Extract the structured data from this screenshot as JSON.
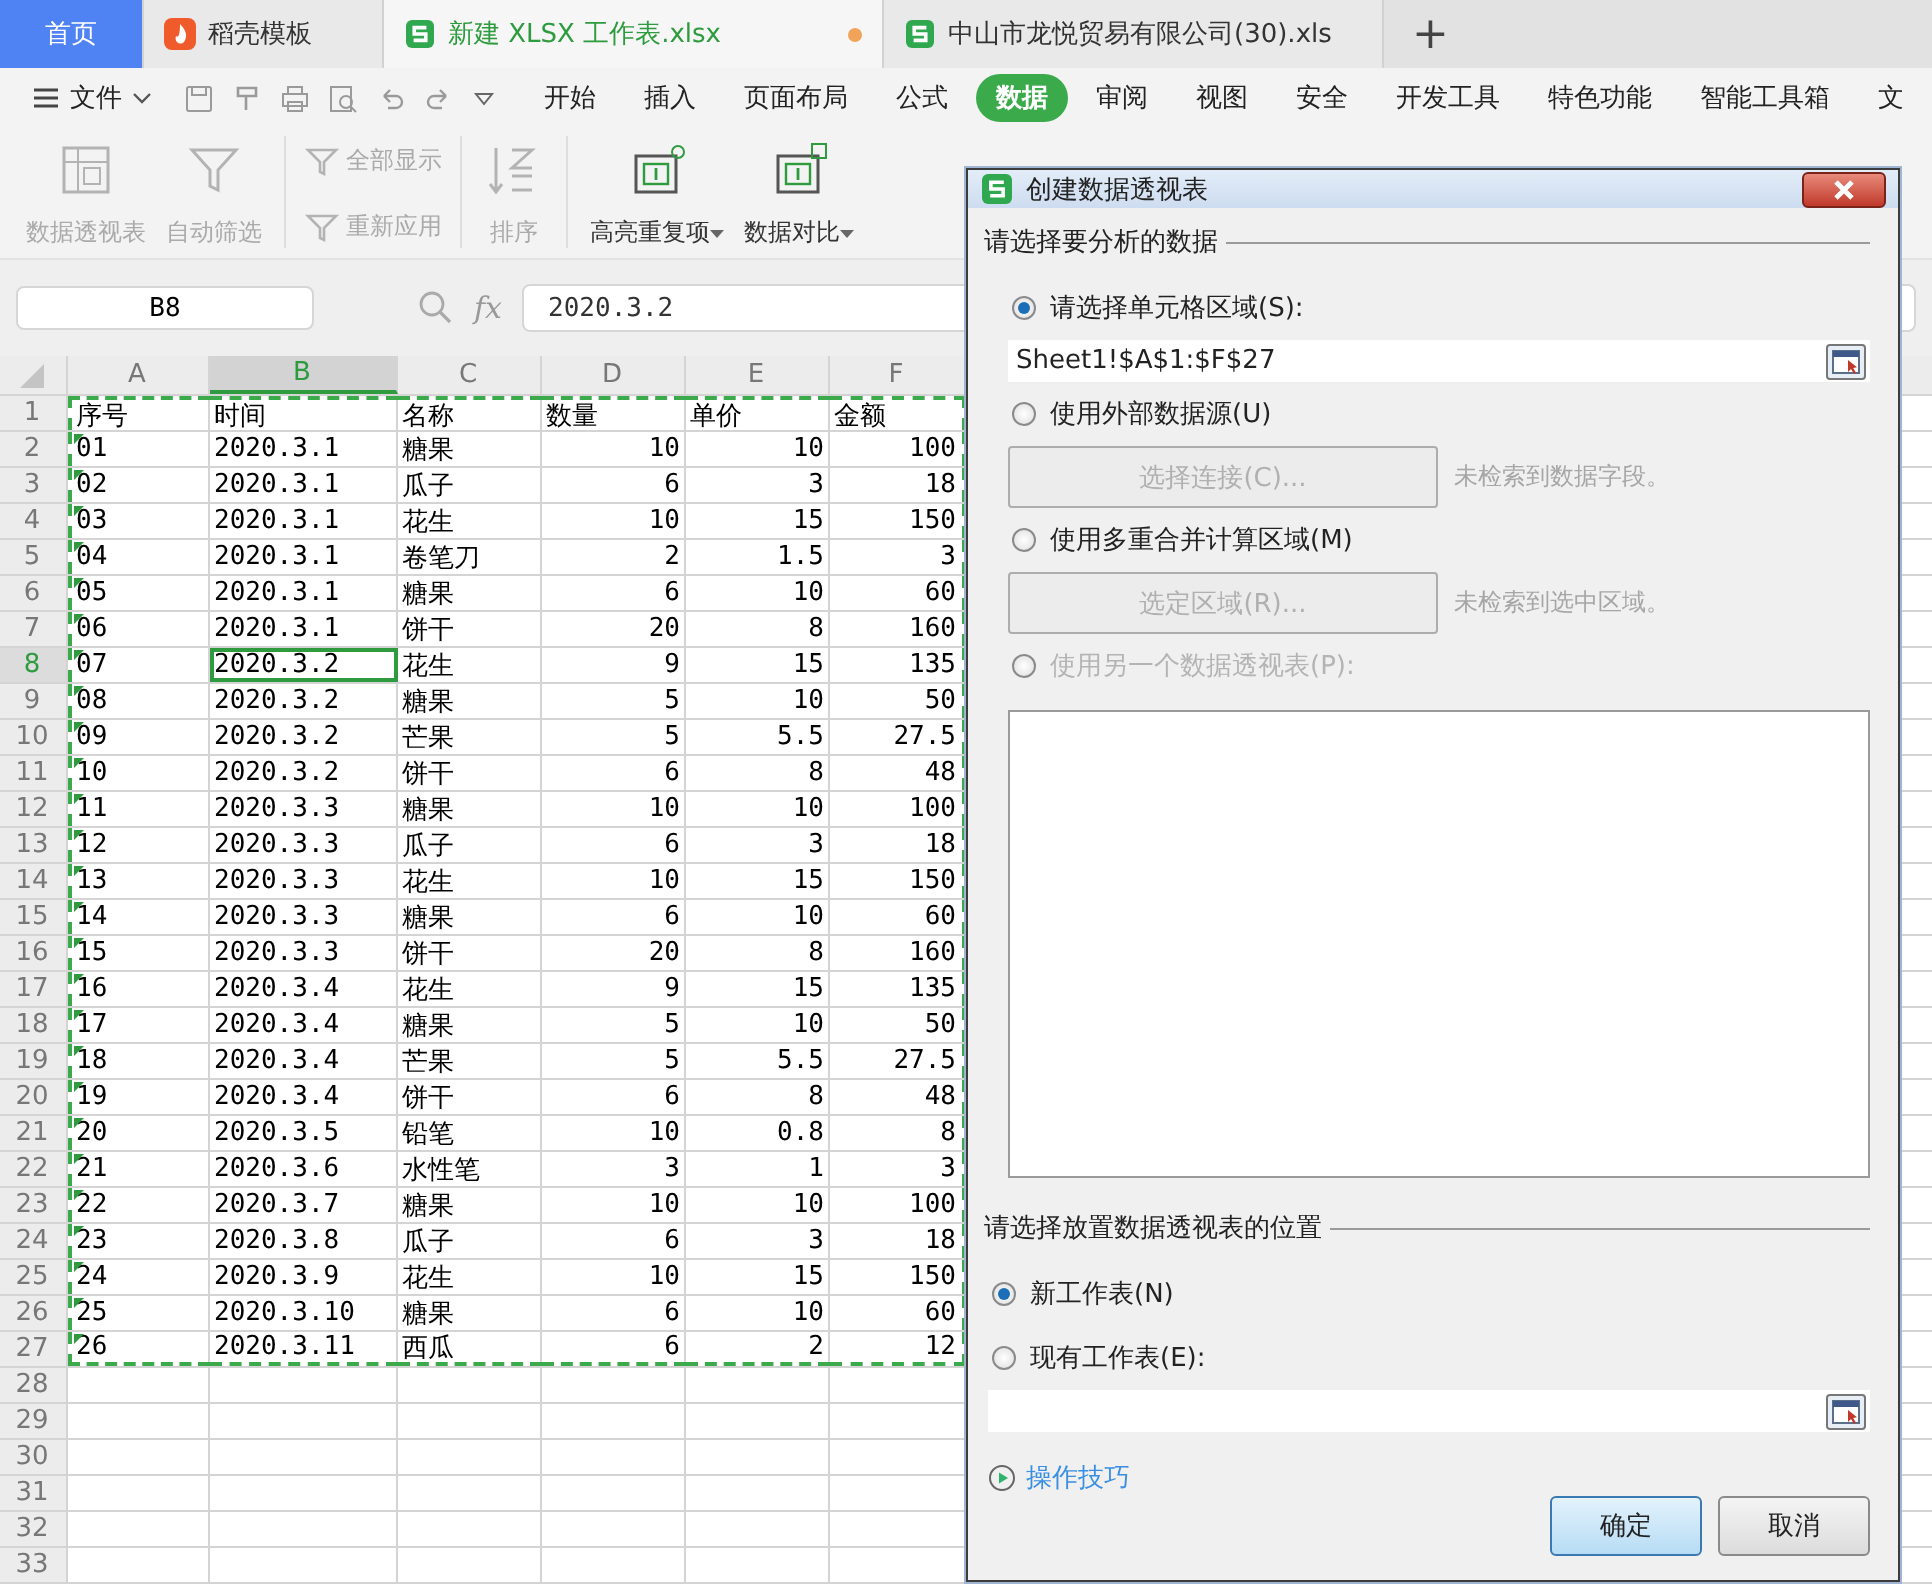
{
  "tabs": [
    {
      "kind": "home",
      "label": "首页",
      "selected": false,
      "modified": false
    },
    {
      "kind": "template",
      "label": "稻壳模板",
      "selected": false,
      "modified": false
    },
    {
      "kind": "sheet",
      "label": "新建 XLSX 工作表.xlsx",
      "selected": true,
      "modified": true
    },
    {
      "kind": "sheet",
      "label": "中山市龙悦贸易有限公司(30).xls",
      "selected": false,
      "modified": false
    }
  ],
  "new_tab": "+",
  "menu": {
    "file": "文件",
    "ribbon_tabs": [
      {
        "label": "开始",
        "selected": false
      },
      {
        "label": "插入",
        "selected": false
      },
      {
        "label": "页面布局",
        "selected": false
      },
      {
        "label": "公式",
        "selected": false
      },
      {
        "label": "数据",
        "selected": true
      },
      {
        "label": "审阅",
        "selected": false
      },
      {
        "label": "视图",
        "selected": false
      },
      {
        "label": "安全",
        "selected": false
      },
      {
        "label": "开发工具",
        "selected": false
      },
      {
        "label": "特色功能",
        "selected": false
      },
      {
        "label": "智能工具箱",
        "selected": false
      },
      {
        "label": "文",
        "selected": false
      }
    ]
  },
  "ribbon": [
    {
      "kind": "large",
      "label": "数据透视表",
      "disabled": true,
      "dropdown": false
    },
    {
      "kind": "large",
      "label": "自动筛选",
      "disabled": true,
      "dropdown": false
    },
    {
      "kind": "small",
      "label": "全部显示",
      "disabled": true,
      "dropdown": false
    },
    {
      "kind": "small",
      "label": "重新应用",
      "disabled": true,
      "dropdown": false
    },
    {
      "kind": "large",
      "label": "排序",
      "disabled": true,
      "dropdown": false
    },
    {
      "kind": "large",
      "label": "高亮重复项",
      "disabled": false,
      "dropdown": true
    },
    {
      "kind": "large",
      "label": "数据对比",
      "disabled": false,
      "dropdown": true
    }
  ],
  "formula_bar": {
    "cell_ref": "B8",
    "fx_label": "fx",
    "value": "2020.3.2"
  },
  "sheet": {
    "copy_marquee": true,
    "columns": [
      {
        "label": "A",
        "selected": false,
        "kind": "text-number"
      },
      {
        "label": "B",
        "selected": true,
        "kind": "text"
      },
      {
        "label": "C",
        "selected": false,
        "kind": "text"
      },
      {
        "label": "D",
        "selected": false,
        "kind": "number"
      },
      {
        "label": "E",
        "selected": false,
        "kind": "number"
      },
      {
        "label": "F",
        "selected": false,
        "kind": "number"
      }
    ],
    "rows": [
      {
        "header": "1",
        "kind": "labels",
        "selected": false,
        "cells": [
          "序号",
          "时间",
          "名称",
          "数量",
          "单价",
          "金额"
        ]
      },
      {
        "header": "2",
        "kind": "data",
        "selected": false,
        "cells": [
          "01",
          "2020.3.1",
          "糖果",
          "10",
          "10",
          "100"
        ]
      },
      {
        "header": "3",
        "kind": "data",
        "selected": false,
        "cells": [
          "02",
          "2020.3.1",
          "瓜子",
          "6",
          "3",
          "18"
        ]
      },
      {
        "header": "4",
        "kind": "data",
        "selected": false,
        "cells": [
          "03",
          "2020.3.1",
          "花生",
          "10",
          "15",
          "150"
        ]
      },
      {
        "header": "5",
        "kind": "data",
        "selected": false,
        "cells": [
          "04",
          "2020.3.1",
          "卷笔刀",
          "2",
          "1.5",
          "3"
        ]
      },
      {
        "header": "6",
        "kind": "data",
        "selected": false,
        "cells": [
          "05",
          "2020.3.1",
          "糖果",
          "6",
          "10",
          "60"
        ]
      },
      {
        "header": "7",
        "kind": "data",
        "selected": false,
        "cells": [
          "06",
          "2020.3.1",
          "饼干",
          "20",
          "8",
          "160"
        ]
      },
      {
        "header": "8",
        "kind": "data",
        "selected": true,
        "cells": [
          "07",
          "2020.3.2",
          "花生",
          "9",
          "15",
          "135"
        ]
      },
      {
        "header": "9",
        "kind": "data",
        "selected": false,
        "cells": [
          "08",
          "2020.3.2",
          "糖果",
          "5",
          "10",
          "50"
        ]
      },
      {
        "header": "10",
        "kind": "data",
        "selected": false,
        "cells": [
          "09",
          "2020.3.2",
          "芒果",
          "5",
          "5.5",
          "27.5"
        ]
      },
      {
        "header": "11",
        "kind": "data",
        "selected": false,
        "cells": [
          "10",
          "2020.3.2",
          "饼干",
          "6",
          "8",
          "48"
        ]
      },
      {
        "header": "12",
        "kind": "data",
        "selected": false,
        "cells": [
          "11",
          "2020.3.3",
          "糖果",
          "10",
          "10",
          "100"
        ]
      },
      {
        "header": "13",
        "kind": "data",
        "selected": false,
        "cells": [
          "12",
          "2020.3.3",
          "瓜子",
          "6",
          "3",
          "18"
        ]
      },
      {
        "header": "14",
        "kind": "data",
        "selected": false,
        "cells": [
          "13",
          "2020.3.3",
          "花生",
          "10",
          "15",
          "150"
        ]
      },
      {
        "header": "15",
        "kind": "data",
        "selected": false,
        "cells": [
          "14",
          "2020.3.3",
          "糖果",
          "6",
          "10",
          "60"
        ]
      },
      {
        "header": "16",
        "kind": "data",
        "selected": false,
        "cells": [
          "15",
          "2020.3.3",
          "饼干",
          "20",
          "8",
          "160"
        ]
      },
      {
        "header": "17",
        "kind": "data",
        "selected": false,
        "cells": [
          "16",
          "2020.3.4",
          "花生",
          "9",
          "15",
          "135"
        ]
      },
      {
        "header": "18",
        "kind": "data",
        "selected": false,
        "cells": [
          "17",
          "2020.3.4",
          "糖果",
          "5",
          "10",
          "50"
        ]
      },
      {
        "header": "19",
        "kind": "data",
        "selected": false,
        "cells": [
          "18",
          "2020.3.4",
          "芒果",
          "5",
          "5.5",
          "27.5"
        ]
      },
      {
        "header": "20",
        "kind": "data",
        "selected": false,
        "cells": [
          "19",
          "2020.3.4",
          "饼干",
          "6",
          "8",
          "48"
        ]
      },
      {
        "header": "21",
        "kind": "data",
        "selected": false,
        "cells": [
          "20",
          "2020.3.5",
          "铅笔",
          "10",
          "0.8",
          "8"
        ]
      },
      {
        "header": "22",
        "kind": "data",
        "selected": false,
        "cells": [
          "21",
          "2020.3.6",
          "水性笔",
          "3",
          "1",
          "3"
        ]
      },
      {
        "header": "23",
        "kind": "data",
        "selected": false,
        "cells": [
          "22",
          "2020.3.7",
          "糖果",
          "10",
          "10",
          "100"
        ]
      },
      {
        "header": "24",
        "kind": "data",
        "selected": false,
        "cells": [
          "23",
          "2020.3.8",
          "瓜子",
          "6",
          "3",
          "18"
        ]
      },
      {
        "header": "25",
        "kind": "data",
        "selected": false,
        "cells": [
          "24",
          "2020.3.9",
          "花生",
          "10",
          "15",
          "150"
        ]
      },
      {
        "header": "26",
        "kind": "data",
        "selected": false,
        "cells": [
          "25",
          "2020.3.10",
          "糖果",
          "6",
          "10",
          "60"
        ]
      },
      {
        "header": "27",
        "kind": "data",
        "selected": false,
        "cells": [
          "26",
          "2020.3.11",
          "西瓜",
          "6",
          "2",
          "12"
        ]
      },
      {
        "header": "28",
        "kind": "empty",
        "selected": false
      },
      {
        "header": "29",
        "kind": "empty",
        "selected": false
      },
      {
        "header": "30",
        "kind": "empty",
        "selected": false
      },
      {
        "header": "31",
        "kind": "empty",
        "selected": false
      },
      {
        "header": "32",
        "kind": "empty",
        "selected": false
      },
      {
        "header": "33",
        "kind": "empty",
        "selected": false
      }
    ]
  },
  "dialog": {
    "title": "创建数据透视表",
    "source_heading": "请选择要分析的数据",
    "source_options": [
      {
        "label": "请选择单元格区域(S):",
        "selected": true,
        "disabled": false,
        "has_field": true,
        "field_value": "Sheet1!$A$1:$F$27"
      },
      {
        "label": "使用外部数据源(U)",
        "selected": false,
        "disabled": false,
        "action": {
          "label": "选择连接(C)...",
          "disabled": true,
          "note": "未检索到数据字段。"
        }
      },
      {
        "label": "使用多重合并计算区域(M)",
        "selected": false,
        "disabled": false,
        "action": {
          "label": "选定区域(R)...",
          "disabled": true,
          "note": "未检索到选中区域。"
        }
      },
      {
        "label": "使用另一个数据透视表(P):",
        "selected": false,
        "disabled": true,
        "list": true
      }
    ],
    "target_heading": "请选择放置数据透视表的位置",
    "target_options": [
      {
        "label": "新工作表(N)",
        "selected": true,
        "disabled": false
      },
      {
        "label": "现有工作表(E):",
        "selected": false,
        "disabled": false,
        "has_field": true
      }
    ],
    "tips_link": "操作技巧",
    "buttons": [
      {
        "label": "确定",
        "default": true
      },
      {
        "label": "取消",
        "default": false
      }
    ]
  }
}
